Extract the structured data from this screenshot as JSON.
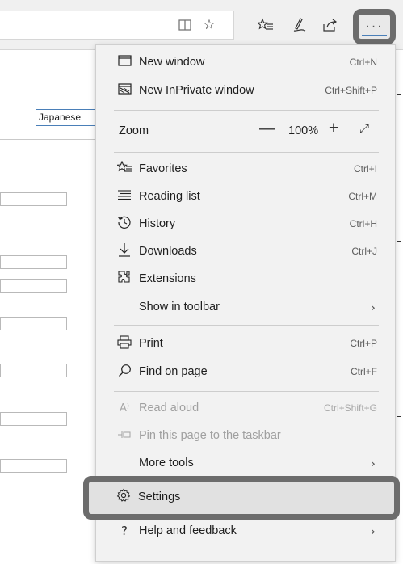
{
  "toolbar": {
    "reading_view_icon": "book-icon",
    "favorite_star_icon": "star-icon",
    "favorites_list_icon": "favorites-list-icon",
    "pen_icon": "pen-icon",
    "share_icon": "share-icon",
    "more_label": "···"
  },
  "background": {
    "language_box_value": "Japanese"
  },
  "menu": {
    "new_window": {
      "icon": "window-icon",
      "label": "New window",
      "shortcut": "Ctrl+N"
    },
    "new_inprivate": {
      "icon": "inprivate-icon",
      "label": "New InPrivate window",
      "shortcut": "Ctrl+Shift+P"
    },
    "zoom": {
      "label": "Zoom",
      "minus": "—",
      "value": "100%",
      "plus": "+",
      "fullscreen": "⤢"
    },
    "favorites": {
      "icon": "favorites-icon",
      "label": "Favorites",
      "shortcut": "Ctrl+I"
    },
    "reading_list": {
      "icon": "reading-list-icon",
      "label": "Reading list",
      "shortcut": "Ctrl+M"
    },
    "history": {
      "icon": "history-icon",
      "label": "History",
      "shortcut": "Ctrl+H"
    },
    "downloads": {
      "icon": "download-icon",
      "label": "Downloads",
      "shortcut": "Ctrl+J"
    },
    "extensions": {
      "icon": "extensions-icon",
      "label": "Extensions"
    },
    "show_in_toolbar": {
      "label": "Show in toolbar",
      "chevron": "›"
    },
    "print": {
      "icon": "print-icon",
      "label": "Print",
      "shortcut": "Ctrl+P"
    },
    "find_on_page": {
      "icon": "search-icon",
      "label": "Find on page",
      "shortcut": "Ctrl+F"
    },
    "read_aloud": {
      "icon": "read-aloud-icon",
      "label": "Read aloud",
      "shortcut": "Ctrl+Shift+G"
    },
    "pin_taskbar": {
      "icon": "pin-icon",
      "label": "Pin this page to the taskbar"
    },
    "more_tools": {
      "label": "More tools",
      "chevron": "›"
    },
    "settings": {
      "icon": "gear-icon",
      "label": "Settings"
    },
    "help": {
      "icon": "help-icon",
      "label": "Help and feedback",
      "chevron": "›"
    }
  },
  "colors": {
    "highlight_border": "#6c6c6c",
    "menu_bg": "#f2f2f2",
    "accent_blue": "#4a7fb8"
  }
}
